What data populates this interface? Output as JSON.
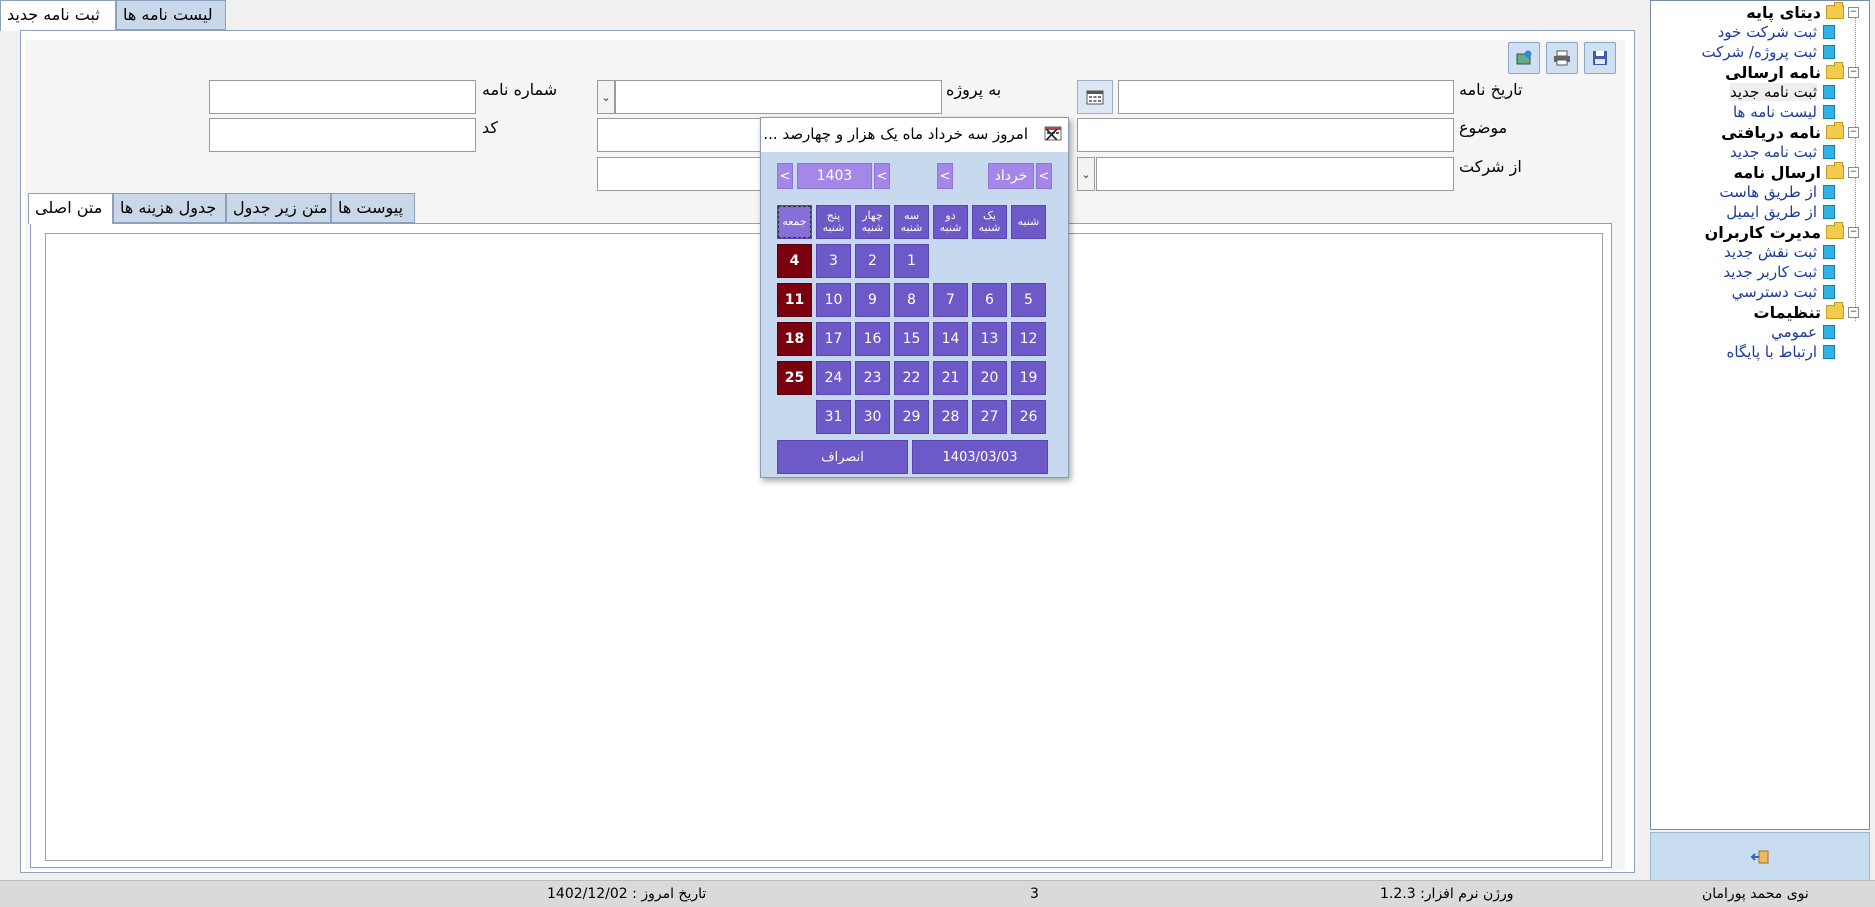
{
  "tabs": {
    "new_letter": "ثبت نامه جدید",
    "letter_list": "ليست نامه ها"
  },
  "form": {
    "letter_date_label": "تاریخ نامه",
    "to_project_label": "به پروژه",
    "letter_number_label": "شماره نامه",
    "subject_label": "موضوع",
    "code_label": "کد",
    "from_company_label": "از شرکت"
  },
  "sub_tabs": {
    "main_text": "متن اصلی",
    "cost_table": "جدول هزینه ها",
    "below_table_text": "متن زیر جدول",
    "attachments": "پیوست ها"
  },
  "sidebar": {
    "groups": [
      {
        "label": "دیتای پایه",
        "items": [
          "ثبت شرکت خود",
          "ثبت پروژه/ شرکت"
        ]
      },
      {
        "label": "نامه ارسالی",
        "items": [
          "ثبت نامه جدید",
          "ليست نامه ها"
        ]
      },
      {
        "label": "نامه دریافتی",
        "items": [
          "ثبت نامه جدید"
        ]
      },
      {
        "label": "ارسال نامه",
        "items": [
          "از طریق هاست",
          "از طریق ایمیل"
        ]
      },
      {
        "label": "مدیرت کاربران",
        "items": [
          "ثبت نقش جدید",
          "ثبت کاربر جدید",
          "ثبت دسترسي"
        ]
      },
      {
        "label": "تنظیمات",
        "items": [
          "عمومي",
          "ارتباط با پایگاه"
        ]
      }
    ]
  },
  "status": {
    "user": "نوی محمد پورامان",
    "version": "ورژن نرم افزار: 1.2.3",
    "count": "3",
    "today": "تاریخ امروز : 1402/12/02"
  },
  "picker": {
    "title": "امروز سه خرداد ماه یک هزار و چهارصد ...",
    "month": "خرداد",
    "year": "1403",
    "prev": "<",
    "next": ">",
    "weekdays": [
      "شنبه",
      "یک شنبه",
      "دو شنبه",
      "سه شنبه",
      "چهار شنبه",
      "پنج شنبه",
      "جمعه"
    ],
    "days": [
      "1",
      "2",
      "3",
      "4",
      "5",
      "6",
      "7",
      "8",
      "9",
      "10",
      "11",
      "12",
      "13",
      "14",
      "15",
      "16",
      "17",
      "18",
      "19",
      "20",
      "21",
      "22",
      "23",
      "24",
      "25",
      "26",
      "27",
      "28",
      "29",
      "30",
      "31"
    ],
    "holidays": [
      "4",
      "11",
      "18",
      "25"
    ],
    "ok_label": "1403/03/03",
    "cancel_label": "انصراف"
  },
  "colors": {
    "day_bg": "#6e59c8",
    "holiday_bg": "#7a0010",
    "nav_bg": "#a487e8",
    "popup_bg": "#c7d9ef"
  }
}
